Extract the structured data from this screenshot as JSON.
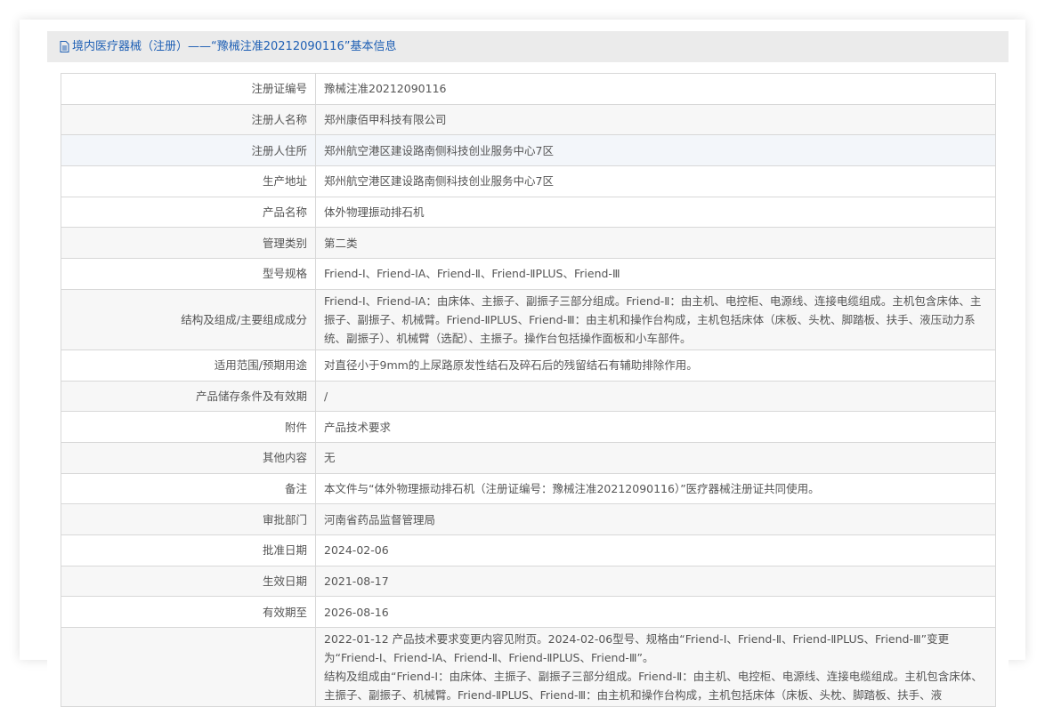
{
  "title": "境内医疗器械（注册）——“豫械注准20212090116”基本信息",
  "rows": [
    {
      "label": "注册证编号",
      "value": "豫械注准20212090116"
    },
    {
      "label": "注册人名称",
      "value": "郑州康佰甲科技有限公司"
    },
    {
      "label": "注册人住所",
      "value": "郑州航空港区建设路南侧科技创业服务中心7区"
    },
    {
      "label": "生产地址",
      "value": "郑州航空港区建设路南侧科技创业服务中心7区"
    },
    {
      "label": "产品名称",
      "value": "体外物理振动排石机"
    },
    {
      "label": "管理类别",
      "value": "第二类"
    },
    {
      "label": "型号规格",
      "value": "Friend-Ⅰ、Friend-ⅠA、Friend-Ⅱ、Friend-ⅡPLUS、Friend-Ⅲ"
    },
    {
      "label": "结构及组成/主要组成成分",
      "value": "Friend-Ⅰ、Friend-ⅠA：由床体、主振子、副振子三部分组成。Friend-Ⅱ：由主机、电控柜、电源线、连接电缆组成。主机包含床体、主振子、副振子、机械臂。Friend-ⅡPLUS、Friend-Ⅲ：由主机和操作台构成，主机包括床体（床板、头枕、脚踏板、扶手、液压动力系统、副振子）、机械臂（选配）、主振子。操作台包括操作面板和小车部件。"
    },
    {
      "label": "适用范围/预期用途",
      "value": "对直径小于9mm的上尿路原发性结石及碎石后的残留结石有辅助排除作用。"
    },
    {
      "label": "产品储存条件及有效期",
      "value": "/"
    },
    {
      "label": "附件",
      "value": "产品技术要求"
    },
    {
      "label": "其他内容",
      "value": "无"
    },
    {
      "label": "备注",
      "value": "本文件与“体外物理振动排石机（注册证编号：豫械注准20212090116）”医疗器械注册证共同使用。"
    },
    {
      "label": "审批部门",
      "value": "河南省药品监督管理局"
    },
    {
      "label": "批准日期",
      "value": "2024-02-06"
    },
    {
      "label": "生效日期",
      "value": "2021-08-17"
    },
    {
      "label": "有效期至",
      "value": "2026-08-16"
    }
  ],
  "change_notes": [
    "2022-01-12 产品技术要求变更内容见附页。2024-02-06型号、规格由“Friend-Ⅰ、Friend-Ⅱ、Friend-ⅡPLUS、Friend-Ⅲ”变更为“Friend-Ⅰ、Friend-ⅠA、Friend-Ⅱ、Friend-ⅡPLUS、Friend-Ⅲ”。",
    "结构及组成由“Friend-Ⅰ：由床体、主振子、副振子三部分组成。Friend-Ⅱ：由主机、电控柜、电源线、连接电缆组成。主机包含床体、主振子、副振子、机械臂。Friend-ⅡPLUS、Friend-Ⅲ：由主机和操作台构成，主机包括床体（床板、头枕、脚踏板、扶手、液"
  ]
}
